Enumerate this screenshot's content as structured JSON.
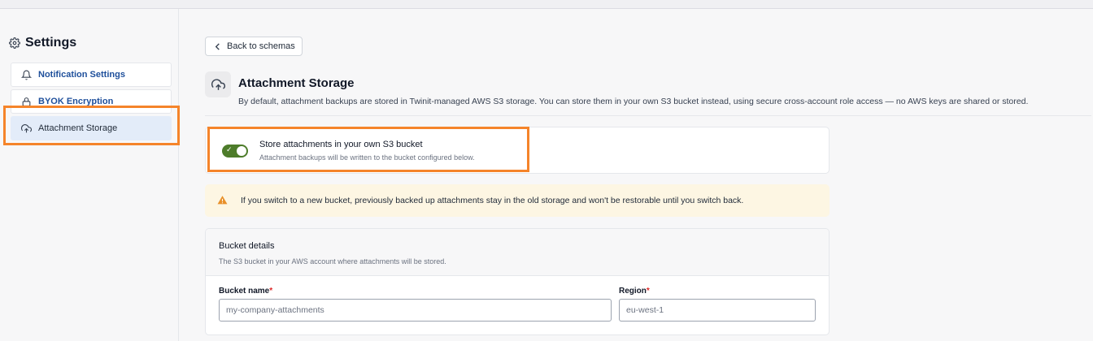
{
  "sidebar": {
    "title": "Settings",
    "items": [
      {
        "label": "Notification Settings",
        "icon": "bell-icon"
      },
      {
        "label": "BYOK Encryption",
        "icon": "lock-icon"
      },
      {
        "label": "Attachment Storage",
        "icon": "cloud-upload-icon",
        "active": true
      }
    ]
  },
  "main": {
    "back_label": "Back to schemas",
    "title": "Attachment Storage",
    "description": "By default, attachment backups are stored in Twinit-managed AWS S3 storage. You can store them in your own S3 bucket instead, using secure cross-account role access — no AWS keys are shared or stored.",
    "toggle": {
      "title": "Store attachments in your own S3 bucket",
      "subtitle": "Attachment backups will be written to the bucket configured below.",
      "on": true
    },
    "warning": "If you switch to a new bucket, previously backed up attachments stay in the old storage and won't be restorable until you switch back.",
    "bucket": {
      "title": "Bucket details",
      "subtitle": "The S3 bucket in your AWS account where attachments will be stored.",
      "name_label": "Bucket name",
      "name_placeholder": "my-company-attachments",
      "region_label": "Region",
      "region_placeholder": "eu-west-1",
      "required_mark": "*"
    }
  },
  "colors": {
    "accent_highlight": "#f5842a",
    "toggle_on": "#4d7c2a",
    "link_blue": "#1e4f9b",
    "active_bg": "#e3ecf9",
    "warning_bg": "#fdf6e3"
  }
}
